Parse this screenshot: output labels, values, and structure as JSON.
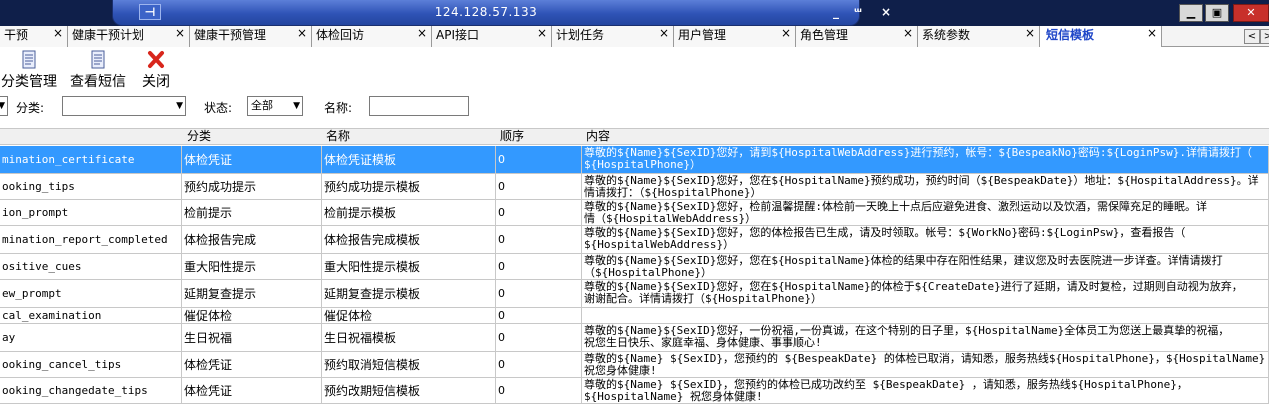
{
  "remote": {
    "title_address": "124.128.57.133",
    "pin_label": "⊣",
    "min": "_",
    "restore": "ᵚ",
    "close": "×"
  },
  "window_buttons": {
    "min": "▁",
    "max": "▣",
    "close": "✕"
  },
  "tabs": [
    {
      "label": "干预"
    },
    {
      "label": "健康干预计划"
    },
    {
      "label": "健康干预管理"
    },
    {
      "label": "体检回访"
    },
    {
      "label": "API接口"
    },
    {
      "label": "计划任务"
    },
    {
      "label": "用户管理"
    },
    {
      "label": "角色管理"
    },
    {
      "label": "系统参数"
    },
    {
      "label": "短信模板",
      "active": true
    }
  ],
  "tab_close": "×",
  "tab_nav": {
    "left": "<",
    "right": ">"
  },
  "toolbar": {
    "category": "分类管理",
    "view": "查看短信",
    "close": "关闭"
  },
  "filter": {
    "category_label": "分类:",
    "category_value": "",
    "status_label": "状态:",
    "status_value": "全部",
    "name_label": "名称:",
    "name_value": ""
  },
  "columns": {
    "category": "分类",
    "name": "名称",
    "order": "顺序",
    "content": "内容"
  },
  "rows": [
    {
      "code": "mination_certificate",
      "category": "体检凭证",
      "name": "体检凭证模板",
      "order": "0",
      "content": [
        "尊敬的${Name}${SexID}您好，请到${HospitalWebAddress}进行预约，帐号：${BespeakNo}密码:${LoginPsw}.详情请拨打（",
        "${HospitalPhone}）"
      ]
    },
    {
      "code": "ooking_tips",
      "category": "预约成功提示",
      "name": "预约成功提示模板",
      "order": "0",
      "content": [
        "尊敬的${Name}${SexID}您好，您在${HospitalName}预约成功，预约时间（${BespeakDate}）地址：${HospitalAddress}。详",
        "情请拨打：（${HospitalPhone}）"
      ]
    },
    {
      "code": "ion_prompt",
      "category": "检前提示",
      "name": "检前提示模板",
      "order": "0",
      "content": [
        "尊敬的${Name}${SexID}您好，检前温馨提醒:体检前一天晚上十点后应避免进食、激烈运动以及饮酒，需保障充足的睡眠。详",
        "情（${HospitalWebAddress}）"
      ]
    },
    {
      "code": "mination_report_completed",
      "category": "体检报告完成",
      "name": "体检报告完成模板",
      "order": "0",
      "content": [
        "尊敬的${Name}${SexID}您好，您的体检报告已生成，请及时领取。帐号：${WorkNo}密码:${LoginPsw}，查看报告（",
        "${HospitalWebAddress}）"
      ]
    },
    {
      "code": "ositive_cues",
      "category": "重大阳性提示",
      "name": "重大阳性提示模板",
      "order": "0",
      "content": [
        "尊敬的${Name}${SexID}您好，您在${HospitalName}体检的结果中存在阳性结果，建议您及时去医院进一步详查。详情请拨打",
        "（${HospitalPhone}）"
      ]
    },
    {
      "code": "ew_prompt",
      "category": "延期复查提示",
      "name": "延期复查提示模板",
      "order": "0",
      "content": [
        "尊敬的${Name}${SexID}您好，您在${HospitalName}的体检于${CreateDate}进行了延期，请及时复检，过期则自动视为放弃，",
        "谢谢配合。详情请拨打（${HospitalPhone}）"
      ]
    },
    {
      "code": "cal_examination",
      "category": "催促体检",
      "name": "催促体检",
      "order": "0",
      "content": []
    },
    {
      "code": "ay",
      "category": "生日祝福",
      "name": "生日祝福模板",
      "order": "0",
      "content": [
        "尊敬的${Name}${SexID}您好，一份祝福,一份真诚，在这个特别的日子里，${HospitalName}全体员工为您送上最真挚的祝福，",
        "祝您生日快乐、家庭幸福、身体健康、事事顺心!"
      ]
    },
    {
      "code": "ooking_cancel_tips",
      "category": "体检凭证",
      "name": "预约取消短信模板",
      "order": "0",
      "content": [
        "尊敬的${Name} ${SexID}，您预约的 ${BespeakDate} 的体检已取消，请知悉，服务热线${HospitalPhone}，${HospitalName}",
        "祝您身体健康!"
      ]
    },
    {
      "code": "ooking_changedate_tips",
      "category": "体检凭证",
      "name": "预约改期短信模板",
      "order": "0",
      "content": [
        "尊敬的${Name} ${SexID}，您预约的体检已成功改约至 ${BespeakDate} ，请知悉，服务热线${HospitalPhone}，",
        "${HospitalName} 祝您身体健康!"
      ]
    }
  ]
}
